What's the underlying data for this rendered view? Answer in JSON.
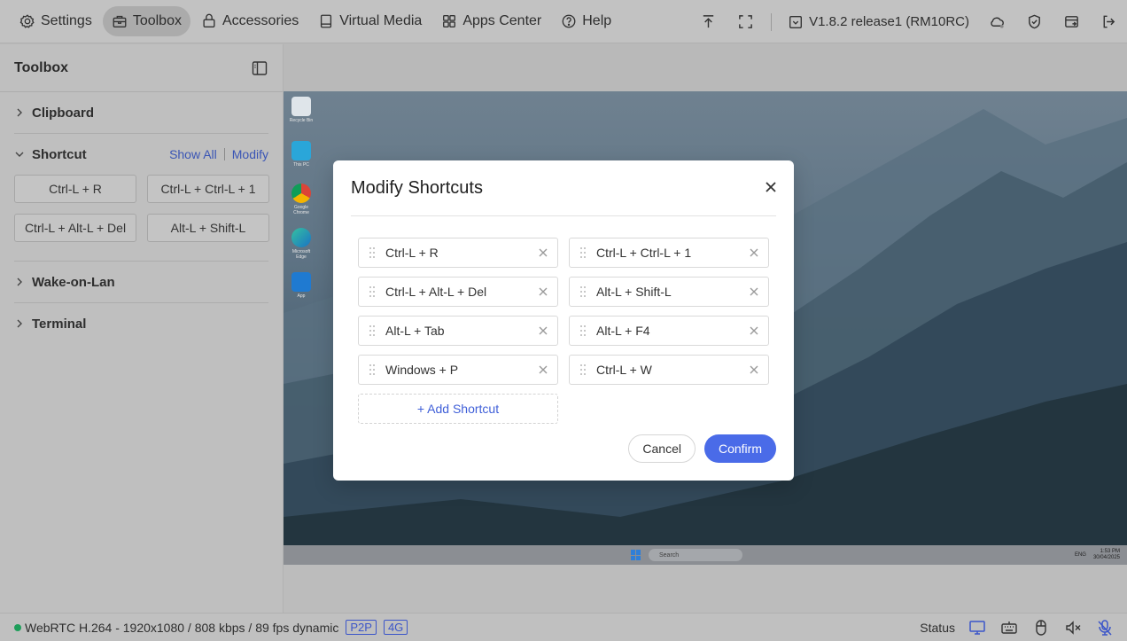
{
  "topbar": {
    "nav": [
      {
        "label": "Settings",
        "icon": "settings-icon"
      },
      {
        "label": "Toolbox",
        "icon": "toolbox-icon",
        "active": true
      },
      {
        "label": "Accessories",
        "icon": "accessories-icon"
      },
      {
        "label": "Virtual Media",
        "icon": "virtual-media-icon"
      },
      {
        "label": "Apps Center",
        "icon": "apps-center-icon"
      },
      {
        "label": "Help",
        "icon": "help-icon"
      }
    ],
    "version": "V1.8.2 release1 (RM10RC)"
  },
  "sidebar": {
    "title": "Toolbox",
    "sections": {
      "clipboard": "Clipboard",
      "shortcut": "Shortcut",
      "show_all": "Show All",
      "modify": "Modify",
      "wake_on_lan": "Wake-on-Lan",
      "terminal": "Terminal"
    },
    "shortcuts": [
      "Ctrl-L + R",
      "Ctrl-L + Ctrl-L + 1",
      "Ctrl-L + Alt-L + Del",
      "Alt-L + Shift-L"
    ]
  },
  "desktop": {
    "icons": [
      "Recycle Bin",
      "This PC",
      "Google Chrome",
      "Microsoft Edge",
      "App"
    ],
    "search_placeholder": "Search",
    "tray_lang": "ENG",
    "tray_time": "1:53 PM",
    "tray_date": "30/04/2025"
  },
  "modal": {
    "title": "Modify Shortcuts",
    "shortcuts": [
      "Ctrl-L + R",
      "Ctrl-L + Ctrl-L + 1",
      "Ctrl-L + Alt-L + Del",
      "Alt-L + Shift-L",
      "Alt-L + Tab",
      "Alt-L + F4",
      "Windows + P",
      "Ctrl-L + W"
    ],
    "add_label": "+ Add Shortcut",
    "cancel_label": "Cancel",
    "confirm_label": "Confirm"
  },
  "statusbar": {
    "connection": "WebRTC H.264 - 1920x1080 /  808 kbps / 89 fps dynamic",
    "badge_p2p": "P2P",
    "badge_4g": "4G",
    "status_label": "Status"
  },
  "colors": {
    "accent": "#4a6be8",
    "link": "#3a55b5",
    "connected": "#1e9e5a"
  }
}
